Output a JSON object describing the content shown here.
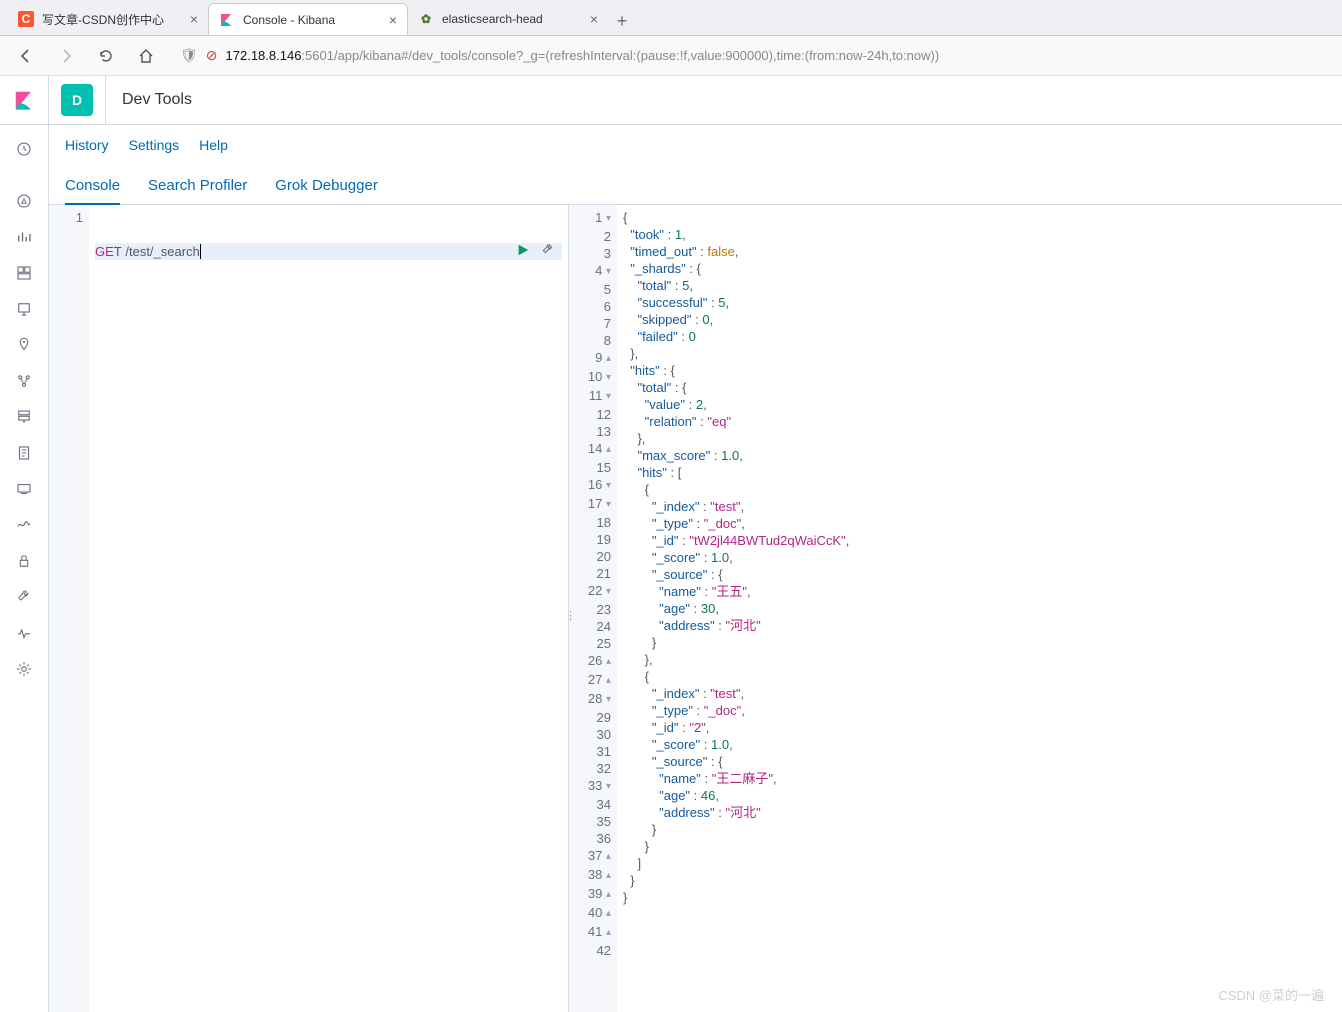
{
  "browser": {
    "tabs": [
      {
        "title": "写文章-CSDN创作中心",
        "icon_bg": "#fc5531",
        "icon_text": "C",
        "icon_color": "#fff"
      },
      {
        "title": "Console - Kibana",
        "icon_bg": "",
        "icon_text": "",
        "icon_color": ""
      },
      {
        "title": "elasticsearch-head",
        "icon_bg": "",
        "icon_text": "",
        "icon_color": ""
      }
    ],
    "url_host": "172.18.8.146",
    "url_path": ":5601/app/kibana#/dev_tools/console?_g=(refreshInterval:(pause:!f,value:900000),time:(from:now-24h,to:now))"
  },
  "kibana": {
    "space_letter": "D",
    "app_title": "Dev Tools",
    "links": {
      "history": "History",
      "settings": "Settings",
      "help": "Help"
    },
    "tabs": {
      "console": "Console",
      "profiler": "Search Profiler",
      "grok": "Grok Debugger"
    }
  },
  "request": {
    "method": "GET",
    "path": "/test/_search"
  },
  "response_lines": [
    {
      "n": 1,
      "fold": "▾",
      "t": [
        [
          "pn",
          "{"
        ]
      ]
    },
    {
      "n": 2,
      "t": [
        [
          "pn",
          "  "
        ],
        [
          "kw",
          "\"took\""
        ],
        [
          "pn",
          " : "
        ],
        [
          "num",
          "1"
        ],
        [
          "pn",
          ","
        ]
      ]
    },
    {
      "n": 3,
      "t": [
        [
          "pn",
          "  "
        ],
        [
          "kw",
          "\"timed_out\""
        ],
        [
          "pn",
          " : "
        ],
        [
          "bool",
          "false"
        ],
        [
          "pn",
          ","
        ]
      ]
    },
    {
      "n": 4,
      "fold": "▾",
      "t": [
        [
          "pn",
          "  "
        ],
        [
          "kw",
          "\"_shards\""
        ],
        [
          "pn",
          " : {"
        ]
      ]
    },
    {
      "n": 5,
      "t": [
        [
          "pn",
          "    "
        ],
        [
          "kw",
          "\"total\""
        ],
        [
          "pn",
          " : "
        ],
        [
          "num",
          "5"
        ],
        [
          "pn",
          ","
        ]
      ]
    },
    {
      "n": 6,
      "t": [
        [
          "pn",
          "    "
        ],
        [
          "kw",
          "\"successful\""
        ],
        [
          "pn",
          " : "
        ],
        [
          "num",
          "5"
        ],
        [
          "pn",
          ","
        ]
      ]
    },
    {
      "n": 7,
      "t": [
        [
          "pn",
          "    "
        ],
        [
          "kw",
          "\"skipped\""
        ],
        [
          "pn",
          " : "
        ],
        [
          "num",
          "0"
        ],
        [
          "pn",
          ","
        ]
      ]
    },
    {
      "n": 8,
      "t": [
        [
          "pn",
          "    "
        ],
        [
          "kw",
          "\"failed\""
        ],
        [
          "pn",
          " : "
        ],
        [
          "num",
          "0"
        ]
      ]
    },
    {
      "n": 9,
      "fold": "▴",
      "t": [
        [
          "pn",
          "  },"
        ]
      ]
    },
    {
      "n": 10,
      "fold": "▾",
      "t": [
        [
          "pn",
          "  "
        ],
        [
          "kw",
          "\"hits\""
        ],
        [
          "pn",
          " : {"
        ]
      ]
    },
    {
      "n": 11,
      "fold": "▾",
      "t": [
        [
          "pn",
          "    "
        ],
        [
          "kw",
          "\"total\""
        ],
        [
          "pn",
          " : {"
        ]
      ]
    },
    {
      "n": 12,
      "t": [
        [
          "pn",
          "      "
        ],
        [
          "kw",
          "\"value\""
        ],
        [
          "pn",
          " : "
        ],
        [
          "num",
          "2"
        ],
        [
          "pn",
          ","
        ]
      ]
    },
    {
      "n": 13,
      "t": [
        [
          "pn",
          "      "
        ],
        [
          "kw",
          "\"relation\""
        ],
        [
          "pn",
          " : "
        ],
        [
          "str",
          "\"eq\""
        ]
      ]
    },
    {
      "n": 14,
      "fold": "▴",
      "t": [
        [
          "pn",
          "    },"
        ]
      ]
    },
    {
      "n": 15,
      "t": [
        [
          "pn",
          "    "
        ],
        [
          "kw",
          "\"max_score\""
        ],
        [
          "pn",
          " : "
        ],
        [
          "num",
          "1.0"
        ],
        [
          "pn",
          ","
        ]
      ]
    },
    {
      "n": 16,
      "fold": "▾",
      "t": [
        [
          "pn",
          "    "
        ],
        [
          "kw",
          "\"hits\""
        ],
        [
          "pn",
          " : ["
        ]
      ]
    },
    {
      "n": 17,
      "fold": "▾",
      "t": [
        [
          "pn",
          "      {"
        ]
      ]
    },
    {
      "n": 18,
      "t": [
        [
          "pn",
          "        "
        ],
        [
          "kw",
          "\"_index\""
        ],
        [
          "pn",
          " : "
        ],
        [
          "str",
          "\"test\""
        ],
        [
          "pn",
          ","
        ]
      ]
    },
    {
      "n": 19,
      "t": [
        [
          "pn",
          "        "
        ],
        [
          "kw",
          "\"_type\""
        ],
        [
          "pn",
          " : "
        ],
        [
          "str",
          "\"_doc\""
        ],
        [
          "pn",
          ","
        ]
      ]
    },
    {
      "n": 20,
      "t": [
        [
          "pn",
          "        "
        ],
        [
          "kw",
          "\"_id\""
        ],
        [
          "pn",
          " : "
        ],
        [
          "str",
          "\"tW2jl44BWTud2qWaiCcK\""
        ],
        [
          "pn",
          ","
        ]
      ]
    },
    {
      "n": 21,
      "t": [
        [
          "pn",
          "        "
        ],
        [
          "kw",
          "\"_score\""
        ],
        [
          "pn",
          " : "
        ],
        [
          "num",
          "1.0"
        ],
        [
          "pn",
          ","
        ]
      ]
    },
    {
      "n": 22,
      "fold": "▾",
      "t": [
        [
          "pn",
          "        "
        ],
        [
          "kw",
          "\"_source\""
        ],
        [
          "pn",
          " : {"
        ]
      ]
    },
    {
      "n": 23,
      "t": [
        [
          "pn",
          "          "
        ],
        [
          "kw",
          "\"name\""
        ],
        [
          "pn",
          " : "
        ],
        [
          "str",
          "\"王五\""
        ],
        [
          "pn",
          ","
        ]
      ]
    },
    {
      "n": 24,
      "t": [
        [
          "pn",
          "          "
        ],
        [
          "kw",
          "\"age\""
        ],
        [
          "pn",
          " : "
        ],
        [
          "num",
          "30"
        ],
        [
          "pn",
          ","
        ]
      ]
    },
    {
      "n": 25,
      "t": [
        [
          "pn",
          "          "
        ],
        [
          "kw",
          "\"address\""
        ],
        [
          "pn",
          " : "
        ],
        [
          "str",
          "\"河北\""
        ]
      ]
    },
    {
      "n": 26,
      "fold": "▴",
      "t": [
        [
          "pn",
          "        }"
        ]
      ]
    },
    {
      "n": 27,
      "fold": "▴",
      "t": [
        [
          "pn",
          "      },"
        ]
      ]
    },
    {
      "n": 28,
      "fold": "▾",
      "t": [
        [
          "pn",
          "      {"
        ]
      ]
    },
    {
      "n": 29,
      "t": [
        [
          "pn",
          "        "
        ],
        [
          "kw",
          "\"_index\""
        ],
        [
          "pn",
          " : "
        ],
        [
          "str",
          "\"test\""
        ],
        [
          "pn",
          ","
        ]
      ]
    },
    {
      "n": 30,
      "t": [
        [
          "pn",
          "        "
        ],
        [
          "kw",
          "\"_type\""
        ],
        [
          "pn",
          " : "
        ],
        [
          "str",
          "\"_doc\""
        ],
        [
          "pn",
          ","
        ]
      ]
    },
    {
      "n": 31,
      "t": [
        [
          "pn",
          "        "
        ],
        [
          "kw",
          "\"_id\""
        ],
        [
          "pn",
          " : "
        ],
        [
          "str",
          "\"2\""
        ],
        [
          "pn",
          ","
        ]
      ]
    },
    {
      "n": 32,
      "t": [
        [
          "pn",
          "        "
        ],
        [
          "kw",
          "\"_score\""
        ],
        [
          "pn",
          " : "
        ],
        [
          "num",
          "1.0"
        ],
        [
          "pn",
          ","
        ]
      ]
    },
    {
      "n": 33,
      "fold": "▾",
      "t": [
        [
          "pn",
          "        "
        ],
        [
          "kw",
          "\"_source\""
        ],
        [
          "pn",
          " : {"
        ]
      ]
    },
    {
      "n": 34,
      "t": [
        [
          "pn",
          "          "
        ],
        [
          "kw",
          "\"name\""
        ],
        [
          "pn",
          " : "
        ],
        [
          "str",
          "\"王二麻子\""
        ],
        [
          "pn",
          ","
        ]
      ]
    },
    {
      "n": 35,
      "t": [
        [
          "pn",
          "          "
        ],
        [
          "kw",
          "\"age\""
        ],
        [
          "pn",
          " : "
        ],
        [
          "num",
          "46"
        ],
        [
          "pn",
          ","
        ]
      ]
    },
    {
      "n": 36,
      "t": [
        [
          "pn",
          "          "
        ],
        [
          "kw",
          "\"address\""
        ],
        [
          "pn",
          " : "
        ],
        [
          "str",
          "\"河北\""
        ]
      ]
    },
    {
      "n": 37,
      "fold": "▴",
      "t": [
        [
          "pn",
          "        }"
        ]
      ]
    },
    {
      "n": 38,
      "fold": "▴",
      "t": [
        [
          "pn",
          "      }"
        ]
      ]
    },
    {
      "n": 39,
      "fold": "▴",
      "t": [
        [
          "pn",
          "    ]"
        ]
      ]
    },
    {
      "n": 40,
      "fold": "▴",
      "t": [
        [
          "pn",
          "  }"
        ]
      ]
    },
    {
      "n": 41,
      "fold": "▴",
      "t": [
        [
          "pn",
          "}"
        ]
      ]
    },
    {
      "n": 42,
      "t": []
    }
  ],
  "watermark": "CSDN @菜的一遍"
}
